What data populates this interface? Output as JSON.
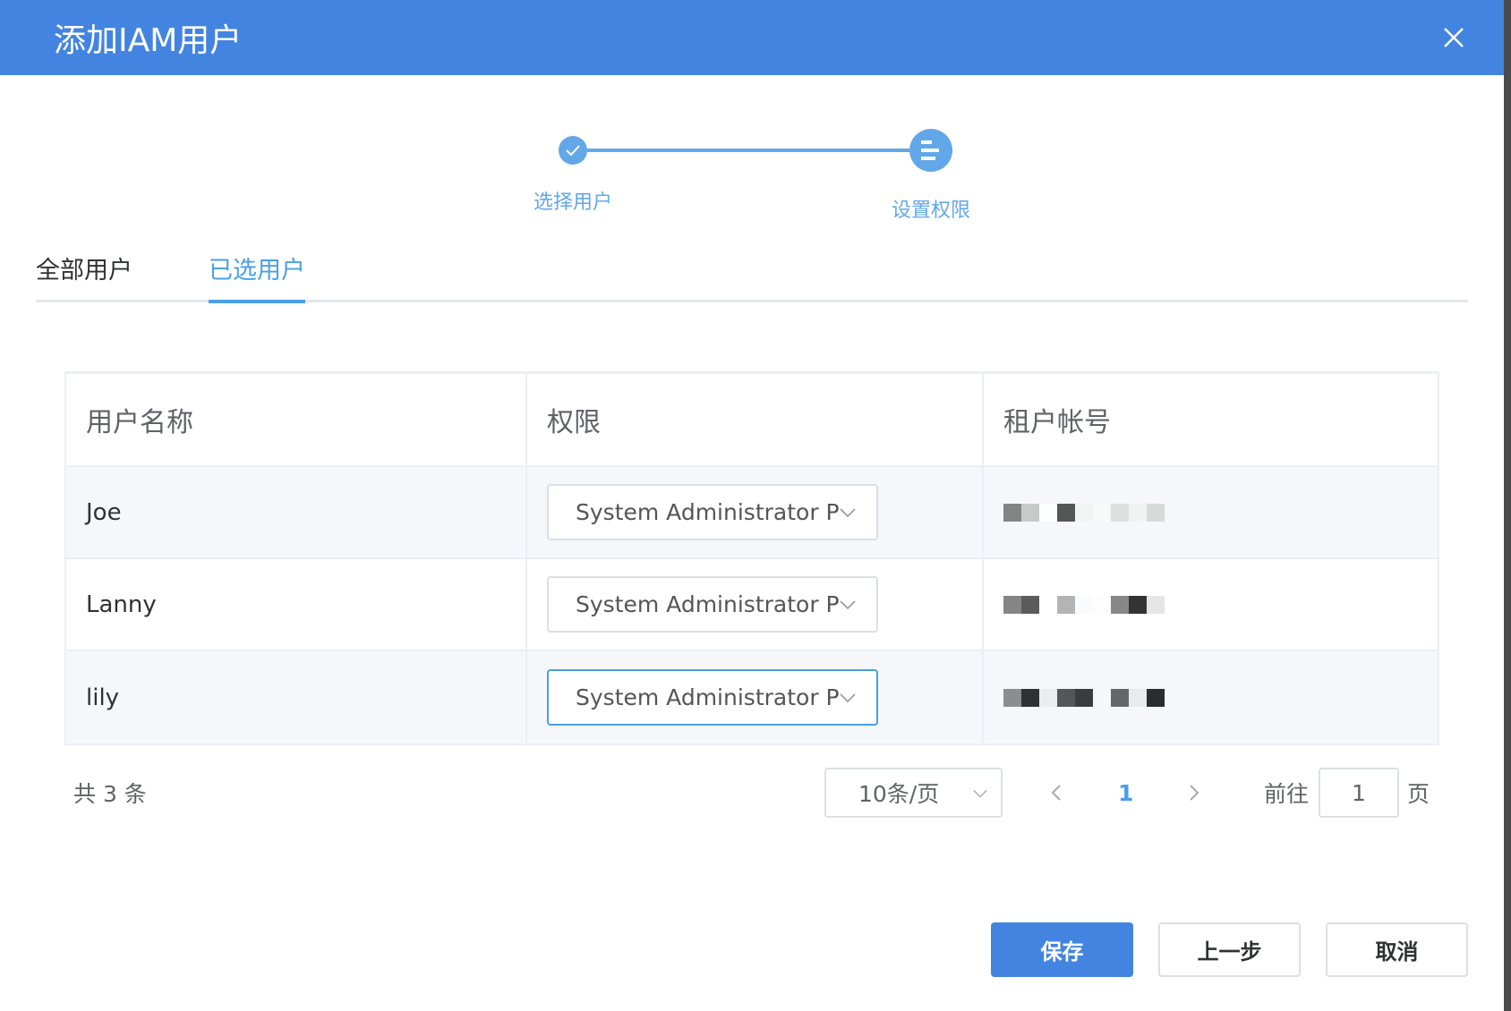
{
  "dialog": {
    "title": "添加IAM用户"
  },
  "steps": [
    {
      "label": "选择用户",
      "status": "done"
    },
    {
      "label": "设置权限",
      "status": "active"
    }
  ],
  "tabs": [
    {
      "label": "全部用户",
      "active": false
    },
    {
      "label": "已选用户",
      "active": true
    }
  ],
  "table": {
    "columns": [
      "用户名称",
      "权限",
      "租户帐号"
    ],
    "rows": [
      {
        "name": "Joe",
        "permission": "System Administrator P",
        "tenant_blocks": [
          "#808685",
          "#c6cbca",
          "#fafeff",
          "#535857",
          "#f0f5f4",
          "#f5fafa",
          "#dbe0df",
          "#eff4f3",
          "#d6dbda"
        ]
      },
      {
        "name": "Lanny",
        "permission": "System Administrator P",
        "tenant_blocks": [
          "#858585",
          "#5b5b5b",
          "#ffffff",
          "#b4b4b4",
          "#fafbfc",
          "#fdfdfd",
          "#878787",
          "#333333",
          "#e6e6e8"
        ]
      },
      {
        "name": "lily",
        "permission": "System Administrator P",
        "tenant_blocks": [
          "#8a8f8e",
          "#303133",
          "#ebeced",
          "#555659",
          "#3b3c3f",
          "#f4f8f8",
          "#656668",
          "#e5eceb",
          "#2b2c2e"
        ]
      }
    ]
  },
  "pagination": {
    "total_label": "共 3 条",
    "page_size": "10条/页",
    "current_page": "1",
    "goto_label": "前往",
    "goto_value": "1",
    "page_suffix": "页"
  },
  "footer": {
    "save": "保存",
    "previous": "上一步",
    "cancel": "取消"
  },
  "colors": {
    "primary": "#4384e0",
    "accent": "#4a9fe8"
  }
}
